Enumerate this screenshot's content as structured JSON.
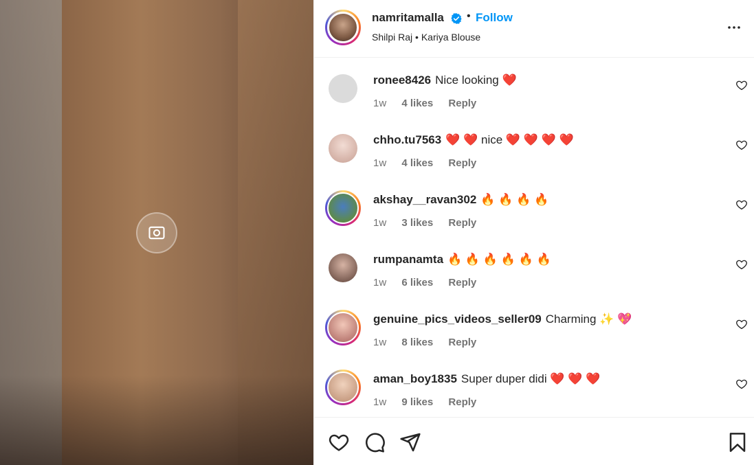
{
  "post": {
    "username": "namritamalla",
    "follow_label": "Follow",
    "dot": "•",
    "audio_artist": "Shilpi Raj",
    "audio_sep": "•",
    "audio_title": "Kariya Blouse"
  },
  "comments": [
    {
      "user": "ronee8426",
      "text": "Nice looking ❤️",
      "time": "1w",
      "likes": "4 likes",
      "reply": "Reply",
      "avatar_style": "plain",
      "avatar_color": "#dbdbdb"
    },
    {
      "user": "chho.tu7563",
      "text": "❤️ ❤️ nice ❤️ ❤️ ❤️ ❤️",
      "time": "1w",
      "likes": "4 likes",
      "reply": "Reply",
      "avatar_style": "plain",
      "avatar_color": "#e7cfc6"
    },
    {
      "user": "akshay__ravan302",
      "text": "🔥 🔥 🔥 🔥",
      "time": "1w",
      "likes": "3 likes",
      "reply": "Reply",
      "avatar_style": "ring",
      "avatar_color": "#5d8a4a"
    },
    {
      "user": "rumpanamta",
      "text": "🔥 🔥 🔥 🔥 🔥 🔥",
      "time": "1w",
      "likes": "6 likes",
      "reply": "Reply",
      "avatar_style": "plain",
      "avatar_color": "#7a5a52"
    },
    {
      "user": "genuine_pics_videos_seller09",
      "text": "Charming ✨ 💖",
      "time": "1w",
      "likes": "8 likes",
      "reply": "Reply",
      "avatar_style": "ring",
      "avatar_color": "#c78f86"
    },
    {
      "user": "aman_boy1835",
      "text": "Super duper didi ❤️ ❤️ ❤️",
      "time": "1w",
      "likes": "9 likes",
      "reply": "Reply",
      "avatar_style": "ring",
      "avatar_color": "#b98a6e"
    }
  ],
  "colors": {
    "link_blue": "#0095f6",
    "text_primary": "#262626",
    "text_secondary": "#737373",
    "verified_blue": "#0095f6"
  },
  "icons": {
    "more": "more-options-icon",
    "like": "heart-icon",
    "comment": "comment-icon",
    "share": "share-icon",
    "save": "bookmark-icon",
    "verified": "verified-badge-icon"
  }
}
